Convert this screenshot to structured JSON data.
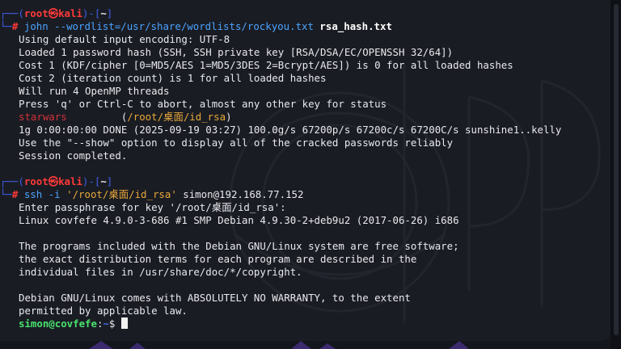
{
  "session1": {
    "frame_top_left": "┌──(",
    "user": "root",
    "at": "㉿",
    "host": "kali",
    "mid": ")-[",
    "cwd": "~",
    "close": "]",
    "frame_bottom": "└─",
    "hash": "#",
    "cmd": "john",
    "arg1": "--wordlist=/usr/share/wordlists/rockyou.txt",
    "arg2": "rsa_hash.txt"
  },
  "john_output": {
    "l1": "Using default input encoding: UTF-8",
    "l2": "Loaded 1 password hash (SSH, SSH private key [RSA/DSA/EC/OPENSSH 32/64])",
    "l3": "Cost 1 (KDF/cipher [0=MD5/AES 1=MD5/3DES 2=Bcrypt/AES]) is 0 for all loaded hashes",
    "l4": "Cost 2 (iteration count) is 1 for all loaded hashes",
    "l5": "Will run 4 OpenMP threads",
    "l6": "Press 'q' or Ctrl-C to abort, almost any other key for status",
    "cracked_password": "starwars",
    "cracked_spacer": "         ",
    "cracked_open": "(",
    "cracked_path": "/root/桌面/id_rsa",
    "cracked_close": ")",
    "l8": "1g 0:00:00:00 DONE (2025-09-19 03:27) 100.0g/s 67200p/s 67200c/s 67200C/s sunshine1..kelly",
    "l9": "Use the \"--show\" option to display all of the cracked passwords reliably",
    "l10": "Session completed."
  },
  "session2": {
    "frame_top_left": "┌──(",
    "user": "root",
    "at": "㉿",
    "host": "kali",
    "mid": ")-[",
    "cwd": "~",
    "close": "]",
    "frame_bottom": "└─",
    "hash": "#",
    "cmd": "ssh",
    "opt": "-i",
    "key_path": "'/root/桌面/id_rsa'",
    "target": "simon@192.168.77.152"
  },
  "ssh_output": {
    "l1": "Enter passphrase for key '/root/桌面/id_rsa':",
    "l2": "Linux covfefe 4.9.0-3-686 #1 SMP Debian 4.9.30-2+deb9u2 (2017-06-26) i686",
    "l3": "The programs included with the Debian GNU/Linux system are free software;",
    "l4": "the exact distribution terms for each program are described in the",
    "l5": "individual files in /usr/share/doc/*/copyright.",
    "l6": "Debian GNU/Linux comes with ABSOLUTELY NO WARRANTY, to the extent",
    "l7": "permitted by applicable law."
  },
  "remote_prompt": {
    "user_host": "simon@covfefe",
    "sep": ":",
    "path": "~",
    "symbol": "$ "
  },
  "colors": {
    "background": "#1a1c23",
    "root_prompt": "#ff3a3a",
    "frame": "#3e5de9",
    "command": "#4aa3ff",
    "string": "#e8a83a",
    "remote_user": "#49e36f"
  }
}
